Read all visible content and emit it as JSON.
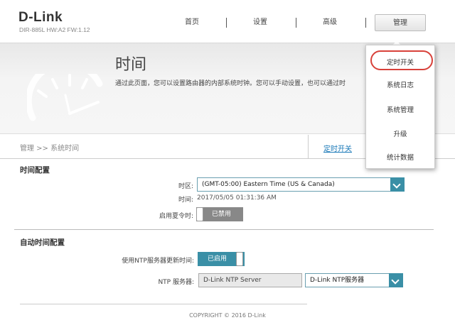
{
  "header": {
    "logo": "D-Link",
    "model": "DIR-885L HW:A2 FW:1.12",
    "nav": [
      {
        "label": "首页"
      },
      {
        "label": "设置"
      },
      {
        "label": "高级"
      },
      {
        "label": "管理",
        "active": true
      }
    ]
  },
  "banner": {
    "title": "时间",
    "description": "通过此页面，您可以设置路由器的内部系统时钟。您可以手动设置，也可以通过时"
  },
  "breadcrumb": {
    "path": "管理 >> 系统时间",
    "link": "定时开关"
  },
  "time_config": {
    "section_title": "时间配置",
    "timezone_label": "时区:",
    "timezone_value": "(GMT-05:00) Eastern Time (US & Canada)",
    "time_label": "时间:",
    "time_value": "2017/05/05 01:31:36 AM",
    "dst_label": "启用夏令时:",
    "dst_state": "已禁用"
  },
  "auto_time_config": {
    "section_title": "自动时间配置",
    "ntp_update_label": "使用NTP服务器更新时间:",
    "ntp_update_state": "已启用",
    "ntp_server_label": "NTP 服务器:",
    "ntp_server_value": "D-Link NTP Server",
    "ntp_server_select": "D-Link NTP服务器"
  },
  "dropdown_menu": {
    "items": [
      "定时开关",
      "系统日志",
      "系统管理",
      "升级",
      "统计数据"
    ],
    "highlighted": "定时开关"
  },
  "footer": {
    "copyright": "COPYRIGHT © 2016 D-Link"
  },
  "colors": {
    "accent": "#3a8fa6",
    "link": "#1a79b8",
    "highlight_ring": "#d8413a",
    "toggle_off": "#888888"
  }
}
